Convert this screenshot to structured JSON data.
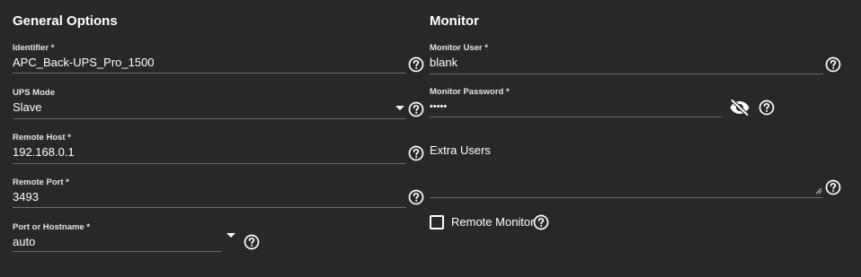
{
  "general": {
    "title": "General Options",
    "identifier": {
      "label": "Identifier *",
      "value": "APC_Back-UPS_Pro_1500"
    },
    "ups_mode": {
      "label": "UPS Mode",
      "value": "Slave"
    },
    "remote_host": {
      "label": "Remote Host *",
      "value": "192.168.0.1"
    },
    "remote_port": {
      "label": "Remote Port *",
      "value": "3493"
    },
    "port_or_hostname": {
      "label": "Port or Hostname *",
      "value": "auto"
    }
  },
  "monitor": {
    "title": "Monitor",
    "monitor_user": {
      "label": "Monitor User *",
      "value": "blank"
    },
    "monitor_password": {
      "label": "Monitor Password *",
      "value": "•••••"
    },
    "extra_users": {
      "label": "Extra Users",
      "value": ""
    },
    "remote_monitor": {
      "label": "Remote Monitor",
      "checked": false
    }
  },
  "icons": {
    "help": "help-circle-icon",
    "visibility_off": "eye-off-icon",
    "dropdown": "chevron-down-icon"
  },
  "colors": {
    "background": "#282828",
    "text": "#ffffff",
    "underline": "#6b6b6b"
  }
}
